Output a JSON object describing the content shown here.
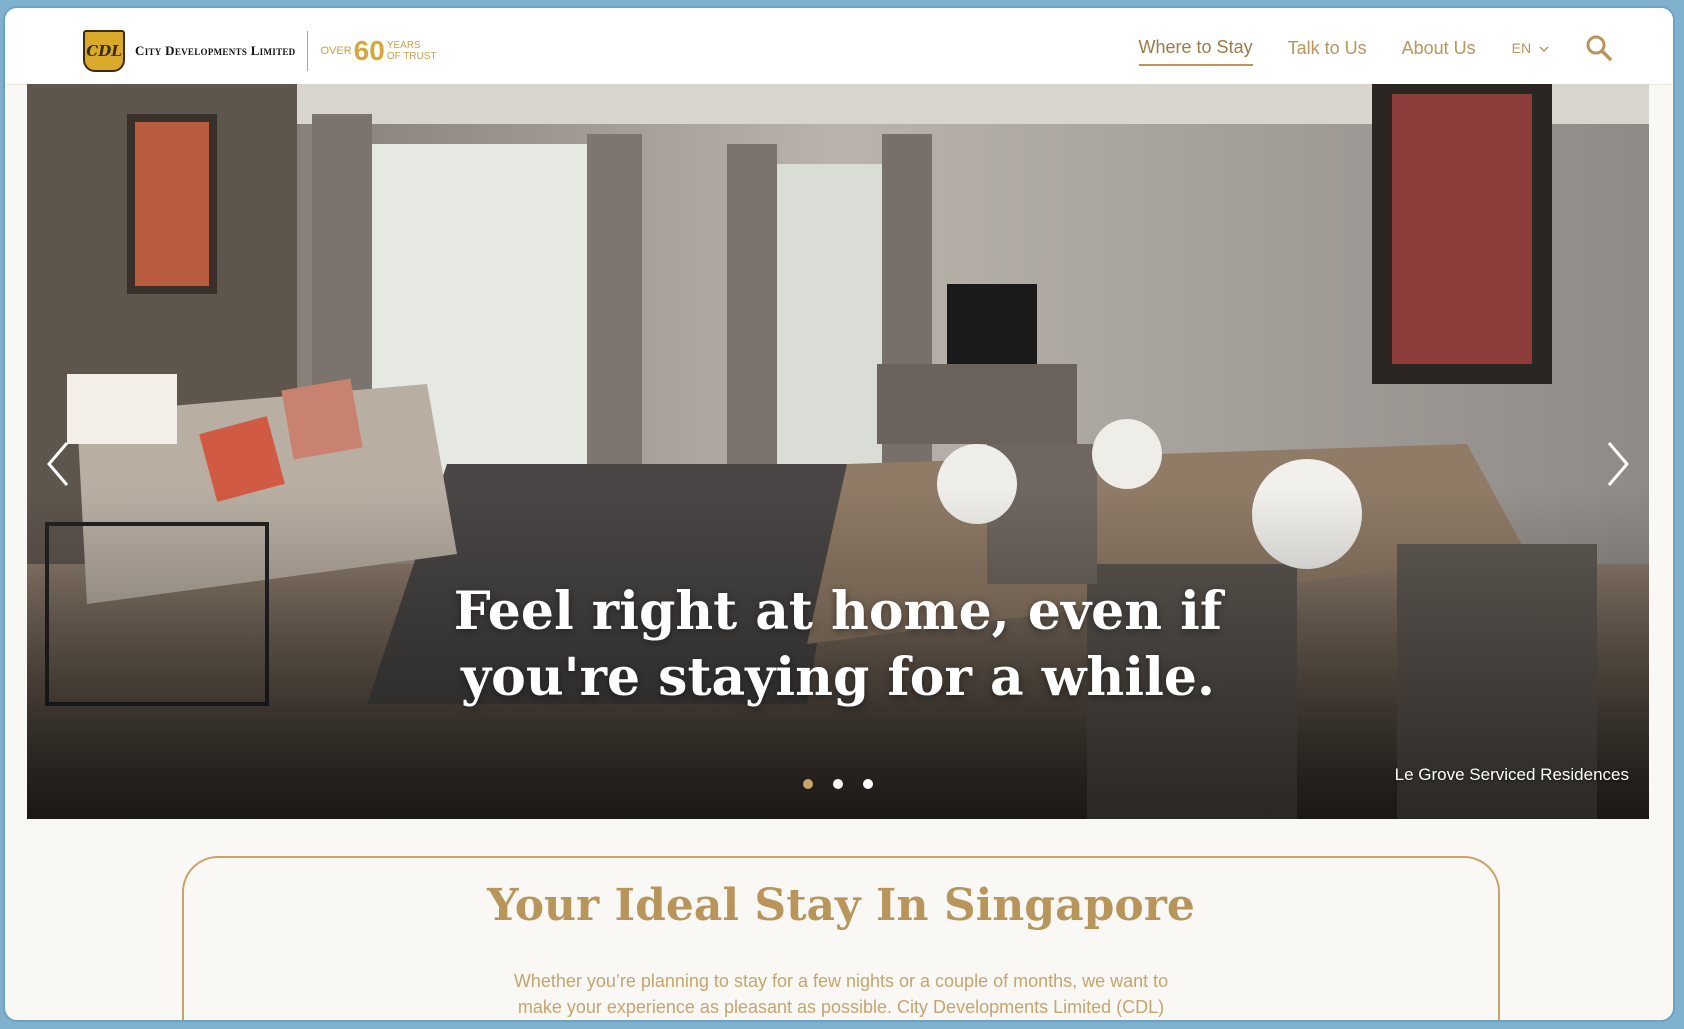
{
  "brand": {
    "logo_mark": "CDL",
    "name": "City Developments Limited",
    "years_over": "OVER",
    "years_number": "60",
    "years_line1": "YEARS",
    "years_line2": "OF TRUST",
    "accent_color": "#b8955b"
  },
  "nav": {
    "items": [
      {
        "label": "Where to Stay",
        "active": true
      },
      {
        "label": "Talk to Us",
        "active": false
      },
      {
        "label": "About Us",
        "active": false
      }
    ],
    "language": "EN",
    "language_icon": "chevron-down-icon",
    "search_icon": "search-icon"
  },
  "hero": {
    "heading_line1": "Feel right at home, even if",
    "heading_line2": "you're staying for a while.",
    "caption": "Le Grove Serviced Residences",
    "prev_icon": "chevron-left-icon",
    "next_icon": "chevron-right-icon",
    "slides_total": 3,
    "active_slide": 1
  },
  "intro": {
    "title": "Your Ideal Stay In Singapore",
    "text": "Whether you’re planning to stay for a few nights or a couple of months, we want to make your experience as pleasant as possible. City Developments Limited (CDL)"
  }
}
